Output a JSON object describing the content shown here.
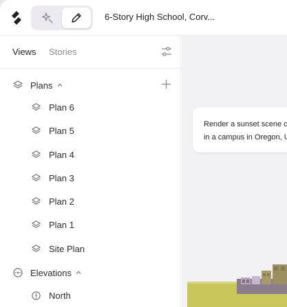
{
  "topbar": {
    "project_title": "6-Story High School, Corv...",
    "modes": [
      {
        "name": "ai-mode",
        "icon": "sparkle-icon"
      },
      {
        "name": "draw-mode",
        "icon": "pencil-icon",
        "active": true
      }
    ]
  },
  "sidebar": {
    "tabs": [
      {
        "label": "Views",
        "active": true
      },
      {
        "label": "Stories",
        "active": false
      }
    ],
    "groups": [
      {
        "label": "Plans",
        "icon": "layers-icon",
        "expanded": true,
        "items": [
          {
            "label": "Plan 6",
            "icon": "layers-icon"
          },
          {
            "label": "Plan 5",
            "icon": "layers-icon"
          },
          {
            "label": "Plan 4",
            "icon": "layers-icon"
          },
          {
            "label": "Plan 3",
            "icon": "layers-icon"
          },
          {
            "label": "Plan 2",
            "icon": "layers-icon"
          },
          {
            "label": "Plan 1",
            "icon": "layers-icon"
          },
          {
            "label": "Site Plan",
            "icon": "layers-icon"
          }
        ]
      },
      {
        "label": "Elevations",
        "icon": "compass-icon",
        "expanded": true,
        "items": [
          {
            "label": "North",
            "icon": "compass-icon"
          }
        ]
      }
    ]
  },
  "canvas": {
    "prompt": {
      "line1": "Render a sunset scene c",
      "line2": "in a campus in Oregon, U"
    }
  },
  "colors": {
    "accent_bg": "#eceaf0",
    "sidebar_text": "#2b2b33",
    "muted_text": "#8b8b96",
    "grass": "#c8c65a",
    "building": "#a89a6a"
  }
}
